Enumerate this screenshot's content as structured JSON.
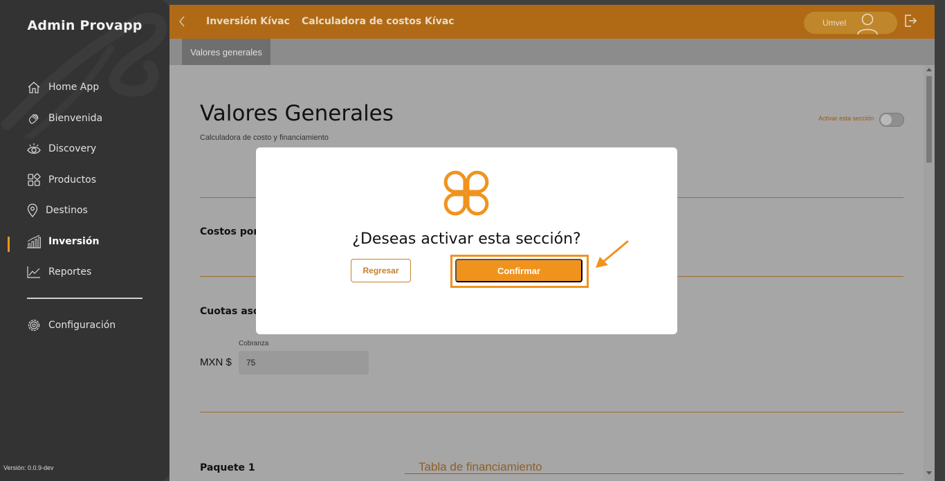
{
  "sidebar": {
    "brand": "Admin Provapp",
    "items": [
      {
        "label": "Home App",
        "icon": "home-icon"
      },
      {
        "label": "Bienvenida",
        "icon": "hand-wave-icon"
      },
      {
        "label": "Discovery",
        "icon": "eye-icon"
      },
      {
        "label": "Productos",
        "icon": "grid-icon"
      },
      {
        "label": "Destinos",
        "icon": "map-pin-icon"
      },
      {
        "label": "Inversión",
        "icon": "bar-chart-icon",
        "active": true
      },
      {
        "label": "Reportes",
        "icon": "line-chart-icon"
      }
    ],
    "settings": {
      "label": "Configuración",
      "icon": "gear-icon"
    },
    "version": "Versión: 0.0.9-dev"
  },
  "header": {
    "crumbs": [
      "Inversión Kívac",
      "Calculadora de costos Kívac"
    ],
    "user": "Umvel"
  },
  "subnav": {
    "active_tab": "Valores generales"
  },
  "page": {
    "title": "Valores Generales",
    "subtitle": "Calculadora de costo y financiamiento",
    "toggle_label": "Activar esta sección",
    "section_costs": "Costos por",
    "section_fees": "Cuotas aso",
    "field_label": "Cobranza",
    "currency": "MXN $",
    "field_value": "75",
    "package": "Paquete 1",
    "financing": "Tabla de financiamiento"
  },
  "modal": {
    "question": "¿Deseas activar esta sección?",
    "back_label": "Regresar",
    "confirm_label": "Confirmar"
  },
  "colors": {
    "accent": "#f0931e",
    "sidebar": "#333333",
    "header": "#b06a16"
  }
}
